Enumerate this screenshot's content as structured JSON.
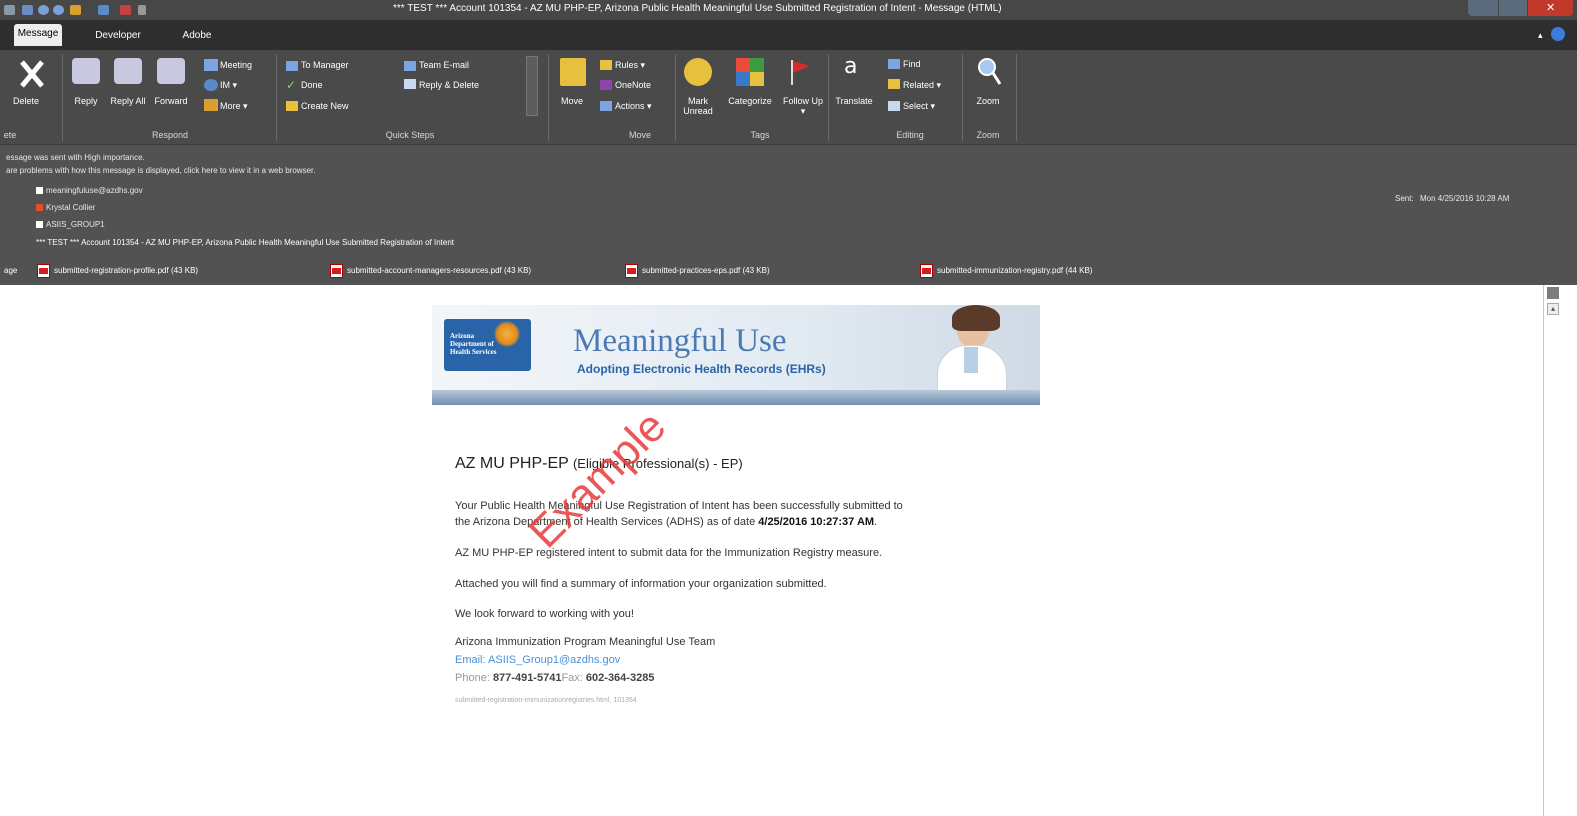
{
  "window": {
    "title": "*** TEST *** Account 101354 - AZ MU PHP-EP, Arizona Public Health Meaningful Use Submitted Registration of Intent - Message (HTML)"
  },
  "tabs": [
    "Message",
    "Developer",
    "Adobe PDF"
  ],
  "ribbon": {
    "delete_group": {
      "delete": "Delete",
      "group_label": "ete"
    },
    "respond": {
      "reply": "Reply",
      "reply_all": "Reply All",
      "forward": "Forward",
      "meeting": "Meeting",
      "im": "IM ▾",
      "more": "More ▾",
      "group_label": "Respond"
    },
    "quick_steps": {
      "to_manager": "To Manager",
      "done": "Done",
      "create_new": "Create New",
      "team_email": "Team E-mail",
      "reply_delete": "Reply & Delete",
      "group_label": "Quick Steps"
    },
    "move": {
      "move": "Move",
      "rules": "Rules ▾",
      "onenote": "OneNote",
      "actions": "Actions ▾",
      "group_label": "Move"
    },
    "tags": {
      "mark_unread": "Mark Unread",
      "categorize": "Categorize",
      "follow_up": "Follow Up ▾",
      "group_label": "Tags"
    },
    "editing": {
      "translate": "Translate",
      "find": "Find",
      "related": "Related ▾",
      "select": "Select ▾",
      "group_label": "Editing"
    },
    "zoom": {
      "zoom": "Zoom",
      "group_label": "Zoom"
    }
  },
  "header": {
    "importance_notice": "essage was sent with High importance.",
    "browser_notice": "are problems with how this message is displayed, click here to view it in a web browser.",
    "from": "meaningfuluse@azdhs.gov",
    "to": "Krystal Collier",
    "cc": "ASIIS_GROUP1",
    "subject": "*** TEST *** Account 101354 - AZ MU PHP-EP, Arizona Public Health Meaningful Use Submitted Registration of Intent",
    "sent_label": "Sent:",
    "sent_value": "Mon 4/25/2016 10:28 AM",
    "attachments_label": "age",
    "attachments": [
      "submitted-registration-profile.pdf (43 KB)",
      "submitted-account-managers-resources.pdf (43 KB)",
      "submitted-practices-eps.pdf (43 KB)",
      "submitted-immunization-registry.pdf (44 KB)"
    ]
  },
  "banner": {
    "logo_lines": [
      "Arizona",
      "Department of",
      "Health Services"
    ],
    "title": "Meaningful Use",
    "subtitle": "Adopting Electronic Health Records (EHRs)"
  },
  "email": {
    "heading_main": "AZ MU PHP-EP",
    "heading_sub": "(Eligible Professional(s) - EP)",
    "para1_line1": "Your Public Health Meaningful Use Registration of Intent has been successfully submitted to",
    "para1_line2_prefix": "the Arizona Department of Health Services (ADHS) as of date",
    "para1_date": "4/25/2016 10:27:37 AM",
    "para1_suffix": ".",
    "para2": "AZ MU PHP-EP registered intent to submit data for the Immunization Registry measure.",
    "para3": "Attached you will find a summary of information your organization submitted.",
    "para4": "We look forward to working with you!",
    "team": "Arizona Immunization Program Meaningful Use Team",
    "email_label": "Email:",
    "email_value": "ASIIS_Group1@azdhs.gov",
    "phone_label": "Phone:",
    "phone_value": "877-491-5741",
    "fax_label": "Fax:",
    "fax_value": "602-364-3285",
    "footer": "submitted-registration-immunizationregistries.html, 101354"
  },
  "watermark": "Example",
  "colors": {
    "titlebar": "#474747",
    "ribbon": "#4a4a4a",
    "header": "#525252",
    "link": "#4a90d9",
    "watermark": "#e83a3a",
    "banner_title": "#3a6ea5"
  }
}
